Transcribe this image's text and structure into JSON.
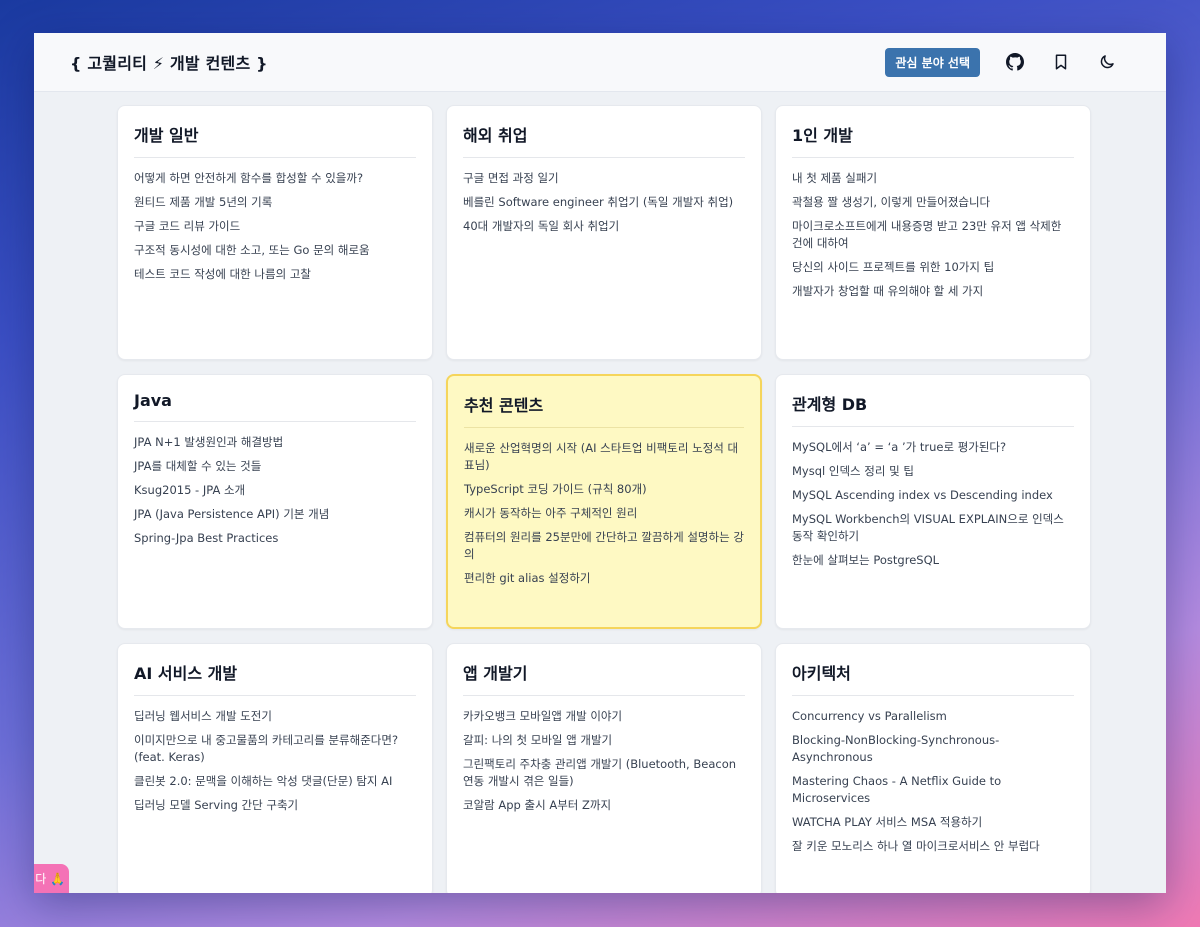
{
  "header": {
    "logo": "{ 고퀄리티 ⚡ 개발 컨텐츠 }",
    "interest_button": "관심 분야 선택"
  },
  "colors": {
    "accent": "#3b73ad",
    "featured_bg": "#fef9c3",
    "featured_border": "#f5d55b",
    "float_tab": "#f472b6"
  },
  "categories": [
    {
      "title": "개발 일반",
      "items": [
        "어떻게 하면 안전하게 함수를 합성할 수 있을까?",
        "원티드 제품 개발 5년의 기록",
        "구글 코드 리뷰 가이드",
        "구조적 동시성에 대한 소고, 또는 Go 문의 해로움",
        "테스트 코드 작성에 대한 나름의 고찰"
      ]
    },
    {
      "title": "해외 취업",
      "items": [
        "구글 면접 과정 일기",
        "베를린 Software engineer 취업기 (독일 개발자 취업)",
        "40대 개발자의 독일 회사 취업기"
      ]
    },
    {
      "title": "1인 개발",
      "items": [
        "내 첫 제품 실패기",
        "곽철용 짤 생성기, 이렇게 만들어졌습니다",
        "마이크로소프트에게 내용증명 받고 23만 유저 앱 삭제한 건에 대하여",
        "당신의 사이드 프로젝트를 위한 10가지 팁",
        "개발자가 창업할 때 유의해야 할 세 가지"
      ]
    },
    {
      "title": "Java",
      "items": [
        "JPA N+1 발생원인과 해결방법",
        "JPA를 대체할 수 있는 것들",
        "Ksug2015 - JPA 소개",
        "JPA (Java Persistence API) 기본 개념",
        "Spring-Jpa Best Practices"
      ]
    },
    {
      "title": "추천 콘텐츠",
      "featured": true,
      "items": [
        "새로운 산업혁명의 시작 (AI 스타트업 비팩토리 노정석 대표님)",
        "TypeScript 코딩 가이드 (규칙 80개)",
        "캐시가 동작하는 아주 구체적인 원리",
        "컴퓨터의 원리를 25분만에 간단하고 깔끔하게 설명하는 강의",
        "편리한 git alias 설정하기"
      ]
    },
    {
      "title": "관계형 DB",
      "items": [
        "MySQL에서 ‘a’ = ‘a ’가 true로 평가된다?",
        "Mysql 인덱스 정리 및 팁",
        "MySQL Ascending index vs Descending index",
        "MySQL Workbench의 VISUAL EXPLAIN으로 인덱스 동작 확인하기",
        "한눈에 살펴보는 PostgreSQL"
      ]
    },
    {
      "title": "AI 서비스 개발",
      "items": [
        "딥러닝 웹서비스 개발 도전기",
        "이미지만으로 내 중고물품의 카테고리를 분류해준다면? (feat. Keras)",
        "클린봇 2.0: 문맥을 이해하는 악성 댓글(단문) 탐지 AI",
        "딥러닝 모델 Serving 간단 구축기"
      ]
    },
    {
      "title": "앱 개발기",
      "items": [
        "카카오뱅크 모바일앱 개발 이야기",
        "갈피: 나의 첫 모바일 앱 개발기",
        "그린팩토리 주차충 관리앱 개발기 (Bluetooth, Beacon 연동 개발시 겪은 일들)",
        "코알람 App 출시 A부터 Z까지"
      ]
    },
    {
      "title": "아키텍처",
      "items": [
        "Concurrency vs Parallelism",
        "Blocking-NonBlocking-Synchronous-Asynchronous",
        "Mastering Chaos - A Netflix Guide to Microservices",
        "WATCHA PLAY 서비스 MSA 적용하기",
        "잘 키운 모노리스 하나 열 마이크로서비스 안 부럽다"
      ]
    }
  ],
  "floating_tab": {
    "text": "다 🙏"
  }
}
